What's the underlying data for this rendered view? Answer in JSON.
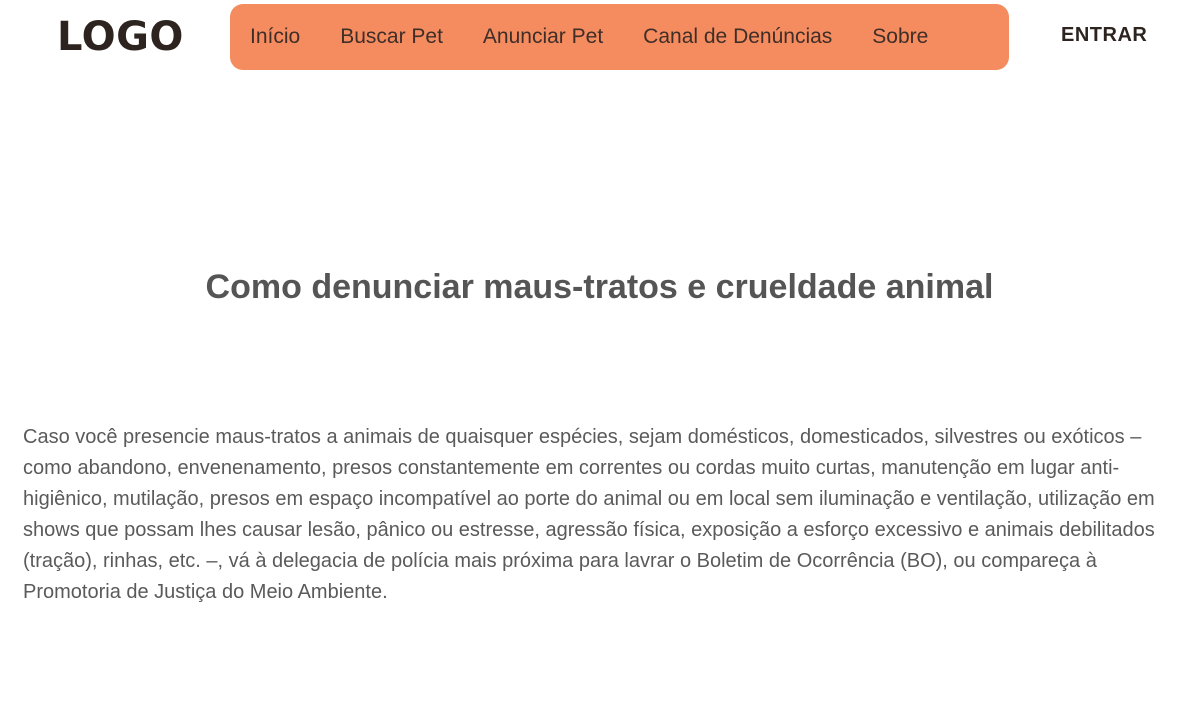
{
  "header": {
    "logo": "LOGO",
    "nav": [
      {
        "label": "Início"
      },
      {
        "label": "Buscar Pet"
      },
      {
        "label": "Anunciar Pet"
      },
      {
        "label": "Canal de Denúncias"
      },
      {
        "label": "Sobre"
      }
    ],
    "login_label": "ENTRAR"
  },
  "main": {
    "title": "Como denunciar maus-tratos e crueldade animal",
    "paragraph": "Caso você presencie maus-tratos a animais de quaisquer espécies, sejam domésticos, domesticados, silvestres ou exóticos – como abandono, envenenamento, presos constantemente em correntes ou cordas muito curtas, manutenção em lugar anti-higiênico, mutilação, presos em espaço incompatível ao porte do animal ou em local sem iluminação e ventilação, utilização em shows que possam lhes causar lesão, pânico ou estresse, agressão física, exposição a esforço excessivo e animais debilitados (tração), rinhas, etc. –, vá à delegacia de polícia mais próxima para lavrar o Boletim de Ocorrência (BO), ou compareça à Promotoria de Justiça do Meio Ambiente."
  },
  "colors": {
    "nav_background": "#f58c60",
    "logo_text": "#2d2420",
    "body_text": "#5a5a5a"
  }
}
